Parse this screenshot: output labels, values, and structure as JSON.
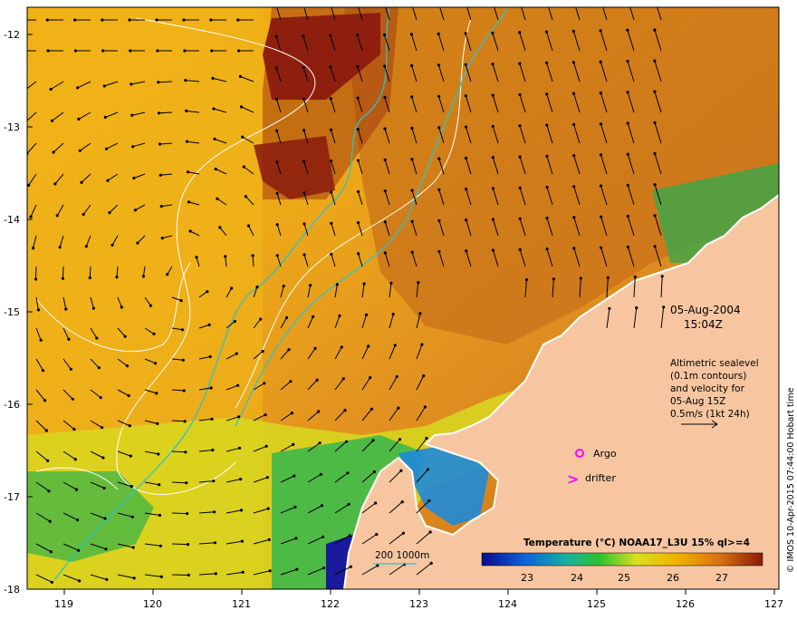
{
  "map": {
    "lat_ticks": [
      "-12",
      "-13",
      "-14",
      "-15",
      "-16",
      "-17",
      "-18"
    ],
    "lon_ticks": [
      "119",
      "120",
      "121",
      "122",
      "123",
      "124",
      "125",
      "126",
      "127"
    ],
    "date": "05-Aug-2004",
    "time": "15:04Z",
    "altimetry_note": [
      "Altimetric sealevel",
      "(0.1m contours)",
      "and velocity for",
      "05-Aug 15Z",
      "0.5m/s (1kt 24h)"
    ],
    "argo_label": "Argo",
    "drifter_label": "drifter",
    "isobath_label": "200  1000m",
    "colorbar_title": "Temperature (°C) NOAA17_L3U 15% ql>=4",
    "colorbar_ticks": [
      "23",
      "24",
      "25",
      "26",
      "27"
    ],
    "credit": "© IMOS 10-Apr-2015 07:44:00 Hobart time",
    "colors": {
      "land": "#f7c6a0",
      "isobath": "#2ec4c4",
      "contour": "#ffffff",
      "argo": "#ff00ff",
      "drifter": "#ff00ff",
      "warm": "#a8400f",
      "mid": "#f0b800",
      "cool": "#2aa84a",
      "cold": "#1a2a9c"
    }
  }
}
